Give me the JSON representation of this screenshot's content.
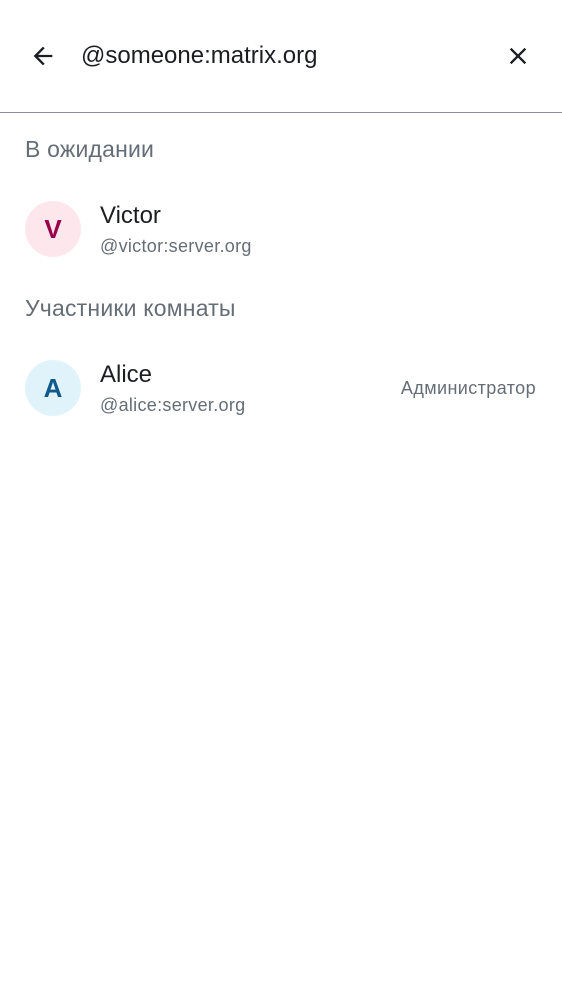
{
  "search": {
    "value": "@someone:matrix.org",
    "back_icon": "arrow-back-icon",
    "clear_icon": "close-icon"
  },
  "sections": {
    "pending_title": "В ожидании",
    "members_title": "Участники комнаты"
  },
  "pending": [
    {
      "initial": "V",
      "name": "Victor",
      "user_id": "@victor:server.org",
      "avatar_bg": "#fde6ec",
      "avatar_fg": "#99004a"
    }
  ],
  "members": [
    {
      "initial": "A",
      "name": "Alice",
      "user_id": "@alice:server.org",
      "role": "Администратор",
      "avatar_bg": "#e1f3fa",
      "avatar_fg": "#0f5a8a"
    }
  ]
}
